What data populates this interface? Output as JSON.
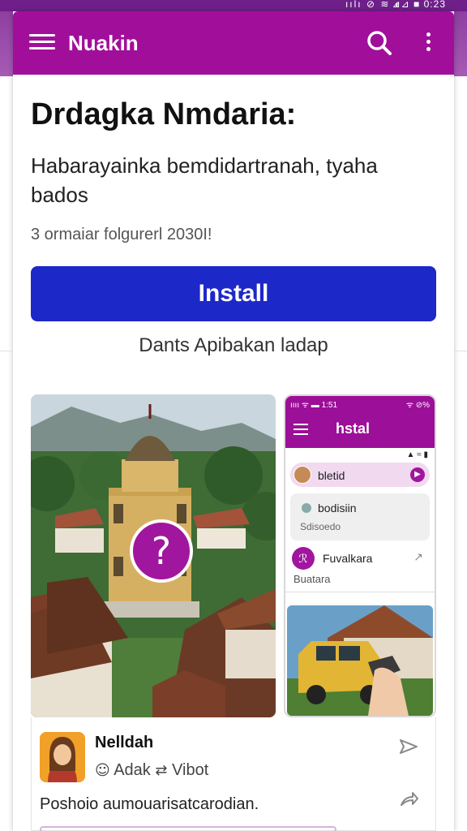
{
  "status_bar": {
    "signal": "ıılı ⊘ ≋ ◐",
    "time": "⊿⊿ ■ 0:23"
  },
  "app_bar": {
    "title": "Nuakin",
    "menu_icon": "hamburger-menu-icon",
    "search_icon": "search-icon",
    "more_icon": "more-vertical-icon"
  },
  "header": {
    "title": "Drdagka Nmdaria:",
    "subtitle": "Habarayainka bemdidartranah, tyaha bados",
    "meta": "3 ormaiar folgurerl 2030I!"
  },
  "install": {
    "label": "Install",
    "caption": "Dants Apibakan ladap"
  },
  "photo": {
    "badge_text": "?"
  },
  "phone_preview": {
    "status_left": "ıııı ᯤ ▬ 1:51",
    "status_right": "ᯤ ⊘%",
    "title": "hstal",
    "signal": "▲ ≈ ▮",
    "chip_label": "bletid",
    "card_title": "bodisiin",
    "card_sub": "Sdisoedo",
    "row_title": "Fuvalkara",
    "row_sub": "Buatara",
    "chip_go": "▶",
    "row_icon": "ℛ",
    "row_share": "↗"
  },
  "post": {
    "name": "Nelldah",
    "action_comment": "Adak",
    "action_repost": "Vibot",
    "description": "Poshoio aumouarisatcarodian."
  },
  "colors": {
    "brand": "#a10f9a",
    "install": "#1d28c8",
    "status": "#6f1f8a"
  }
}
